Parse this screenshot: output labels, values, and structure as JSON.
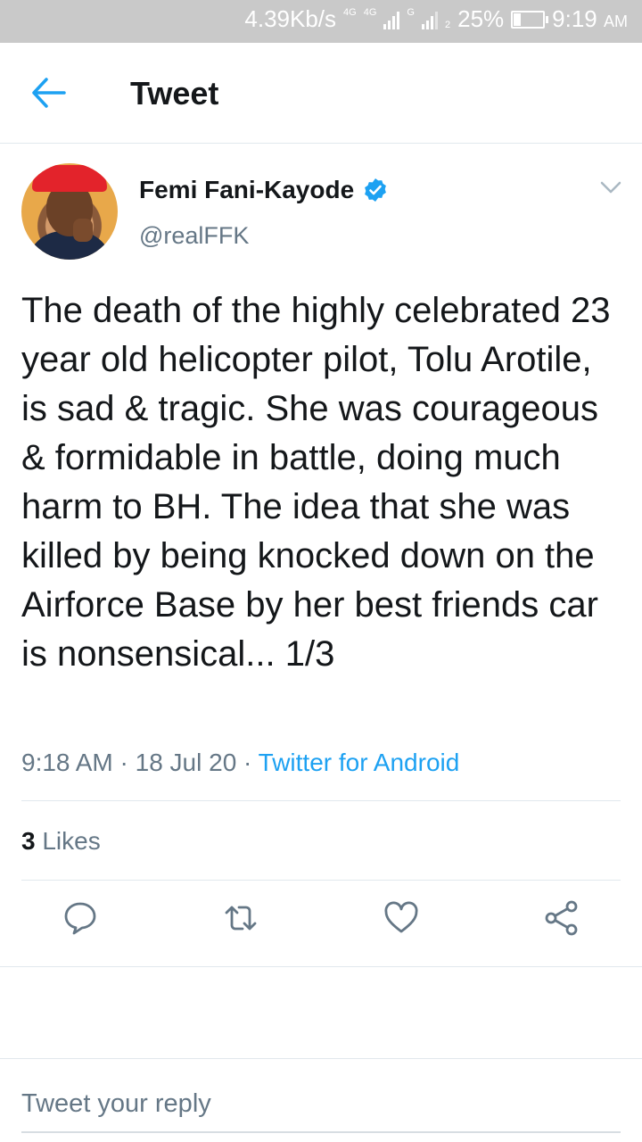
{
  "status_bar": {
    "net_speed": "4.39Kb/s",
    "network_a": "4G",
    "network_b": "4G",
    "network_c": "G",
    "sim_2": "2",
    "battery": "25%",
    "battery_level": 0.25,
    "time": "9:19",
    "am_pm": "AM"
  },
  "appbar": {
    "title": "Tweet",
    "back_icon": "arrow-left-icon",
    "accent": "#1da1f2"
  },
  "tweet": {
    "author_name": "Femi Fani-Kayode",
    "handle": "@realFFK",
    "verified": true,
    "text": "The death of the highly celebrated 23 year old helicopter pilot, Tolu Arotile, is sad & tragic. She was courageous & formidable in battle, doing much harm to BH. The idea that she was killed by being knocked down on the Airforce Base by her best friends car is nonsensical... 1/3",
    "time": "9:18 AM",
    "separator": "·",
    "date": "18 Jul 20",
    "source": "Twitter for Android",
    "likes_count": "3",
    "likes_label": "Likes"
  },
  "actions": [
    {
      "icon": "reply-icon"
    },
    {
      "icon": "retweet-icon"
    },
    {
      "icon": "heart-icon"
    },
    {
      "icon": "share-icon"
    }
  ],
  "reply": {
    "placeholder": "Tweet your reply"
  },
  "colors": {
    "text": "#14171a",
    "secondary": "#657786",
    "link": "#1da1f2",
    "border": "#e1e8ed",
    "status_bar": "#c9c9c9"
  }
}
